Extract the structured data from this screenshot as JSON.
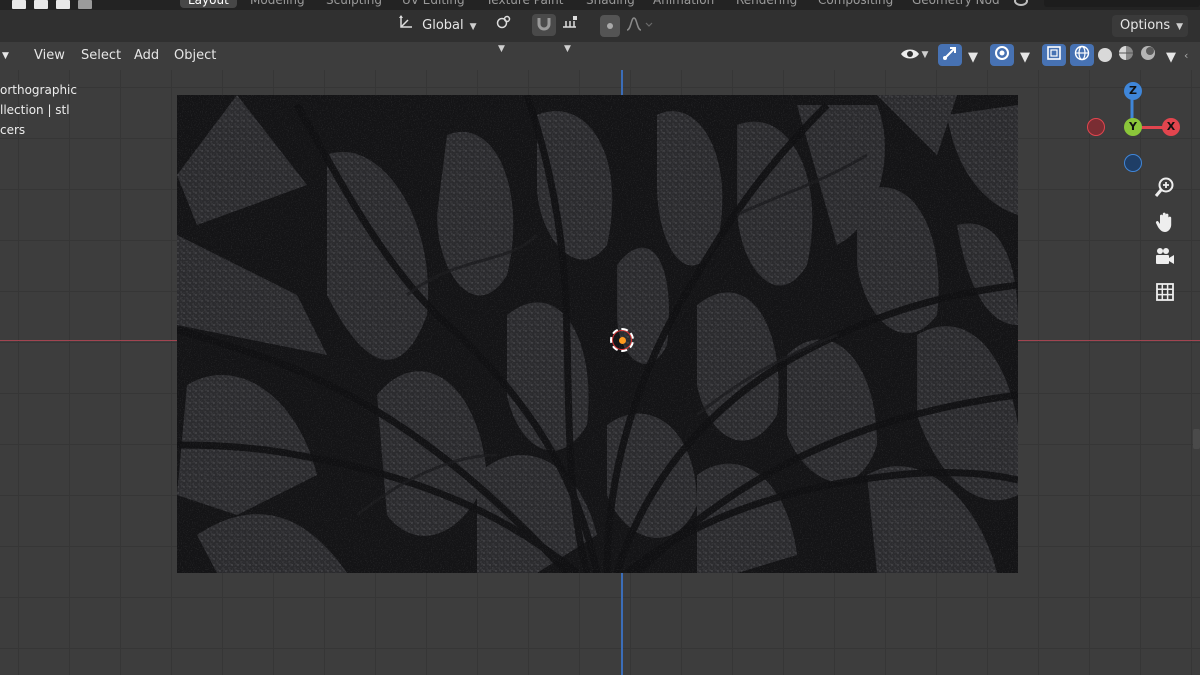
{
  "workspace_tabs": [
    "Layout",
    "Modeling",
    "Sculpting",
    "UV Editing",
    "Texture Paint",
    "Shading",
    "Animation",
    "Rendering",
    "Compositing",
    "Geometry Nod"
  ],
  "toolbar": {
    "transform_orientation": "Global",
    "options_label": "Options"
  },
  "header": {
    "menus": [
      "View",
      "Select",
      "Add",
      "Object"
    ]
  },
  "viewport_overlay": {
    "view_name": "orthographic",
    "collection_line": "llection | stl",
    "extra_line": "cers"
  },
  "gizmo": {
    "z_label": "Z",
    "y_label": "Y",
    "x_label": "X"
  },
  "colors": {
    "x_axis": "#a14551",
    "y_axis": "#3b6db8",
    "gizmo_x": "#e2454e",
    "gizmo_y": "#8bc63a",
    "gizmo_z": "#3f86d9",
    "accent": "#4772b3"
  }
}
